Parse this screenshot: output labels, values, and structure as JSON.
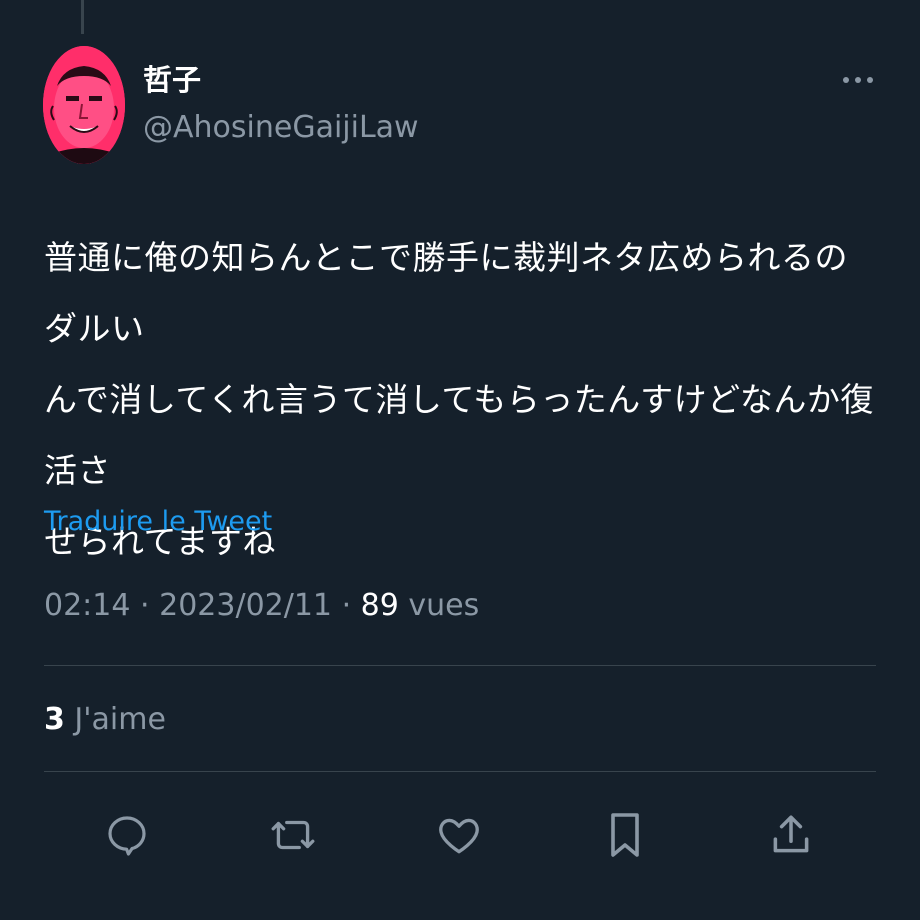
{
  "tweet": {
    "author": {
      "display_name": "哲子",
      "handle": "@AhosineGaijiLaw"
    },
    "text_lines": [
      "普通に俺の知らんとこで勝手に裁判ネタ広められるのダルい",
      "んで消してくれ言うて消してもらったんすけどなんか復活さ",
      "せられてますね"
    ],
    "translate_label": "Traduire le Tweet",
    "time": "02:14",
    "date": "2023/02/11",
    "separator": "·",
    "views_count": "89",
    "views_label": "vues",
    "likes_count": "3",
    "likes_label": "J'aime"
  },
  "actions": [
    {
      "icon": "reply-icon"
    },
    {
      "icon": "retweet-icon"
    },
    {
      "icon": "like-icon"
    },
    {
      "icon": "bookmark-icon"
    },
    {
      "icon": "share-icon"
    }
  ],
  "colors": {
    "background": "#15202b",
    "text": "#ffffff",
    "secondary": "#8b98a5",
    "link": "#1d9bf0",
    "divider": "#38444d",
    "avatar": "#ff2e6a"
  }
}
